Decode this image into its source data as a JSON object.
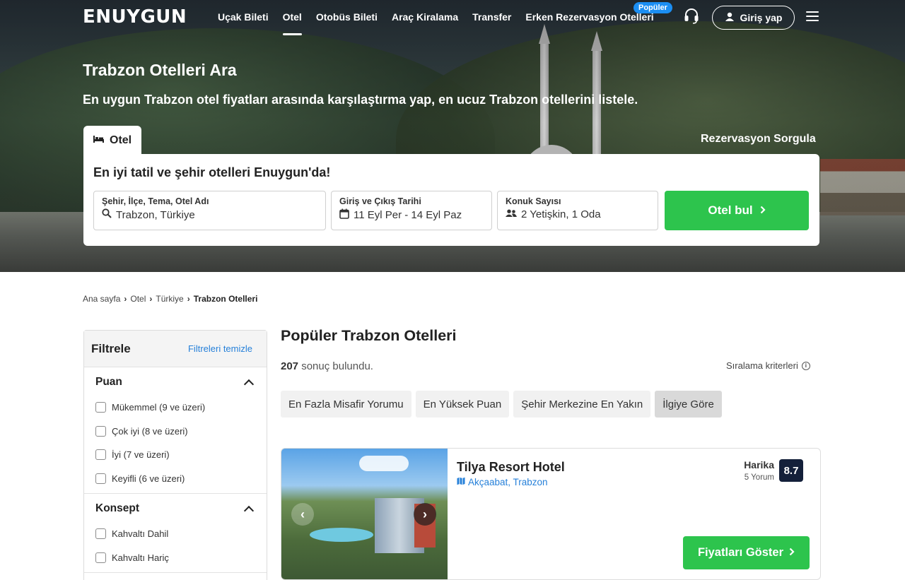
{
  "header": {
    "logo": "ENUYGUN",
    "nav": [
      "Uçak Bileti",
      "Otel",
      "Otobüs Bileti",
      "Araç Kiralama",
      "Transfer",
      "Erken Rezervasyon Otelleri"
    ],
    "active_nav": "Otel",
    "popular_badge": "Popüler",
    "login_label": "Giriş yap"
  },
  "hero": {
    "title": "Trabzon Otelleri Ara",
    "subtitle": "En uygun Trabzon otel fiyatları arasında karşılaştırma yap, en ucuz Trabzon otellerini listele.",
    "tab_label": "Otel",
    "reservation_link": "Rezervasyon Sorgula"
  },
  "search": {
    "heading": "En iyi tatil ve şehir otelleri Enuygun'da!",
    "destination_label": "Şehir, İlçe, Tema, Otel Adı",
    "destination_value": "Trabzon, Türkiye",
    "dates_label": "Giriş ve Çıkış Tarihi",
    "dates_value": "11 Eyl Per - 14 Eyl Paz",
    "guests_label": "Konuk Sayısı",
    "guests_value": "2 Yetişkin, 1 Oda",
    "submit_label": "Otel bul"
  },
  "breadcrumb": [
    "Ana sayfa",
    "Otel",
    "Türkiye",
    "Trabzon Otelleri"
  ],
  "filters": {
    "title": "Filtrele",
    "clear_label": "Filtreleri temizle",
    "sections": [
      {
        "title": "Puan",
        "options": [
          "Mükemmel (9 ve üzeri)",
          "Çok iyi (8 ve üzeri)",
          "İyi (7 ve üzeri)",
          "Keyifli (6 ve üzeri)"
        ]
      },
      {
        "title": "Konsept",
        "options": [
          "Kahvaltı Dahil",
          "Kahvaltı Hariç"
        ]
      }
    ]
  },
  "results": {
    "title": "Popüler Trabzon Otelleri",
    "count": "207",
    "count_suffix": "sonuç bulundu.",
    "sort_criteria_label": "Sıralama kriterleri",
    "sort_options": [
      "En Fazla Misafir Yorumu",
      "En Yüksek Puan",
      "Şehir Merkezine En Yakın",
      "İlgiye Göre"
    ],
    "active_sort": "İlgiye Göre"
  },
  "hotels": [
    {
      "name": "Tilya Resort Hotel",
      "location": "Akçaabat, Trabzon",
      "rating_word": "Harika",
      "reviews": "5 Yorum",
      "score": "8.7",
      "cta": "Fiyatları Göster"
    }
  ],
  "colors": {
    "accent_green": "#2dc44d",
    "link_blue": "#2680d9",
    "score_navy": "#14203a",
    "badge_blue": "#1b8ef3"
  }
}
